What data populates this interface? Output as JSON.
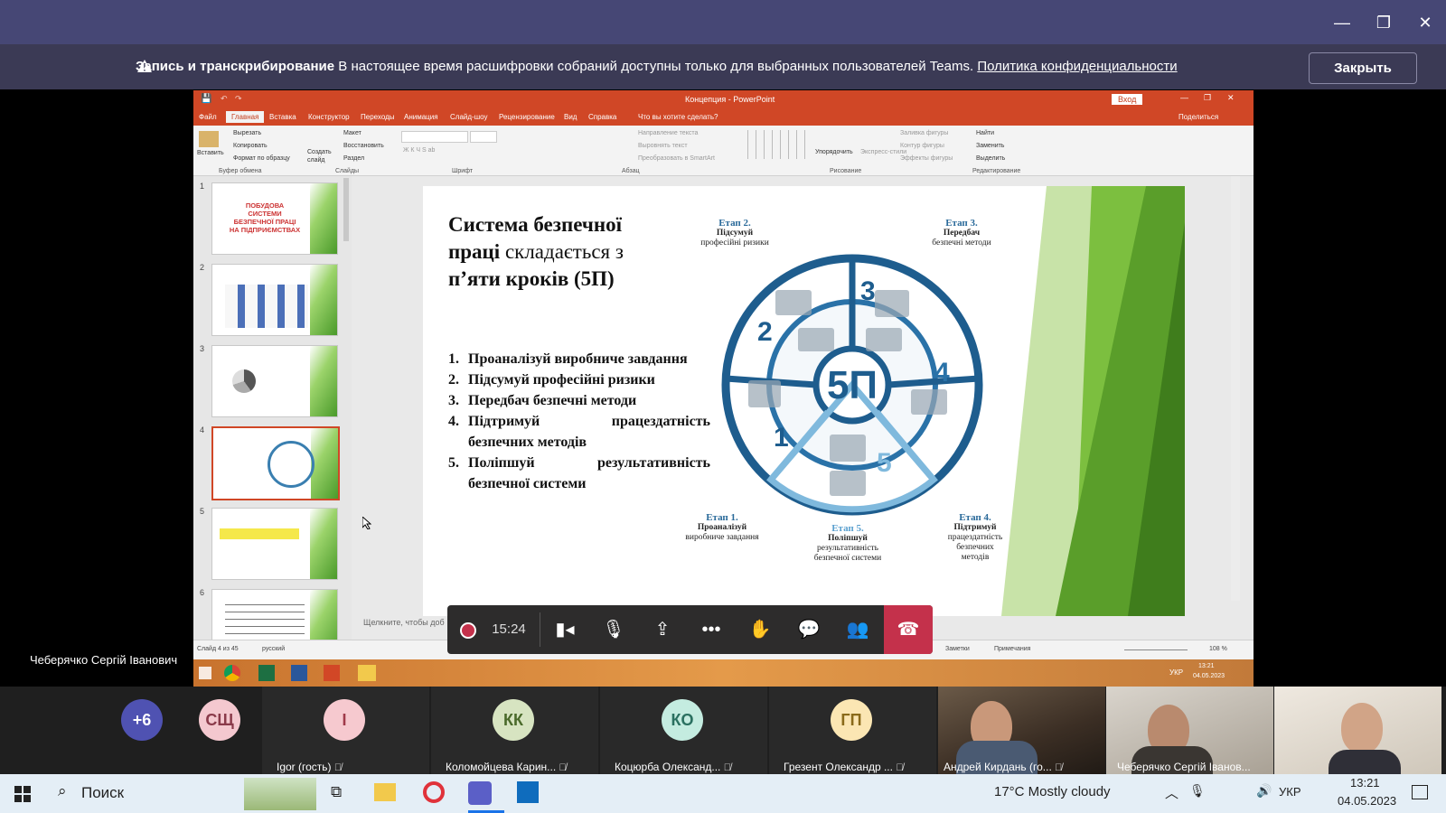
{
  "window": {
    "minimize": "—",
    "maximize": "❐",
    "close": "✕"
  },
  "banner": {
    "title": "Запись и транскрибирование",
    "message": "В настоящее время расшифровки собраний доступны только для выбранных пользователей Teams.",
    "link": "Политика конфиденциальности",
    "close_label": "Закрыть"
  },
  "powerpoint": {
    "title": "Концепция - PowerPoint",
    "signin": "Вход",
    "share": "Поделиться",
    "tabs": [
      "Файл",
      "Главная",
      "Вставка",
      "Конструктор",
      "Переходы",
      "Анимация",
      "Слайд-шоу",
      "Рецензирование",
      "Вид",
      "Справка",
      "Что вы хотите сделать?"
    ],
    "ribbon": {
      "paste": "Вставить",
      "cut": "Вырезать",
      "copy": "Копировать",
      "format": "Формат по образцу",
      "clipboard": "Буфер обмена",
      "new_slide": "Создать слайд",
      "layout": "Макет",
      "reset": "Восстановить",
      "section": "Раздел",
      "slides": "Слайды",
      "font": "Шрифт",
      "paragraph": "Абзац",
      "text_dir": "Направление текста",
      "align_text": "Выровнять текст",
      "smartart": "Преобразовать в SmartArt",
      "arrange": "Упорядочить",
      "quick_styles": "Экспресс-стили",
      "fill": "Заливка фигуры",
      "outline": "Контур фигуры",
      "effects": "Эффекты фигуры",
      "drawing": "Рисование",
      "find": "Найти",
      "replace": "Заменить",
      "select": "Выделить",
      "editing": "Редактирование"
    },
    "thumb_numbers": [
      "1",
      "2",
      "3",
      "4",
      "5",
      "6"
    ],
    "thumb1_text": "ПОБУДОВА СИСТЕМИ БЕЗПЕЧНОЇ ПРАЦІ НА ПІДПРИЄМСТВАХ",
    "notes_placeholder": "Щелкните, чтобы доб",
    "status": {
      "slide": "Слайд 4 из 45",
      "lang": "русский",
      "notes": "Заметки",
      "comments": "Примечания",
      "zoom": "108 %"
    },
    "tray": {
      "lang": "УКР",
      "time": "13:21",
      "date": "04.05.2023"
    }
  },
  "slide": {
    "title_bold_1": "Система безпечної",
    "title_bold_2": "праці",
    "title_normal": " складається з",
    "title_bold_3": "п’яти кроків (5П)",
    "steps": [
      {
        "n": "1.",
        "text": "Проаналізуй виробниче завдання"
      },
      {
        "n": "2.",
        "text": "Підсумуй професійні ризики"
      },
      {
        "n": "3.",
        "text": "Передбач безпечні методи"
      },
      {
        "n": "4.",
        "text": "Підтримуй працездатність безпечних методів"
      },
      {
        "n": "5.",
        "text": "Поліпшуй результативність безпечної системи"
      }
    ],
    "center": "5П",
    "sector_numbers": [
      "1",
      "2",
      "3",
      "4",
      "5"
    ],
    "etap2": {
      "h": "Етап 2.",
      "b": "Підсумуй",
      "t": "професійні ризики"
    },
    "etap3": {
      "h": "Етап 3.",
      "b": "Передбач",
      "t": "безпечні методи"
    },
    "etap1": {
      "h": "Етап 1.",
      "b": "Проаналізуй",
      "t": "виробниче завдання"
    },
    "etap5": {
      "h": "Етап 5.",
      "b": "Поліпшуй",
      "t": "результативність безпечної системи"
    },
    "etap4": {
      "h": "Етап 4.",
      "b": "Підтримуй",
      "t": "працездатність безпечних методів"
    }
  },
  "call": {
    "timer": "15:24"
  },
  "presenter": "Чеберячко Сергій Іванович",
  "participants": [
    {
      "initials": "+6",
      "name": "",
      "color": "#4f52b2",
      "fg": "#ffffff"
    },
    {
      "initials": "СЩ",
      "name": "",
      "color": "#f4c8cf",
      "fg": "#8a3a4a"
    },
    {
      "initials": "I",
      "name": "Igor (гость)",
      "color": "#f6c9cf",
      "fg": "#a03a4a"
    },
    {
      "initials": "КК",
      "name": "Коломойцева Карин...",
      "color": "#d7e4c1",
      "fg": "#4a6a2a"
    },
    {
      "initials": "КО",
      "name": "Коцюрба Олександ...",
      "color": "#c4ece0",
      "fg": "#2a7060"
    },
    {
      "initials": "ГП",
      "name": "Грезент Олександр ...",
      "color": "#fbe6b3",
      "fg": "#8a6a1a"
    }
  ],
  "video_names": [
    "Андрей Кирдань (го...",
    "Чеберячко Сергій Іванов...",
    ""
  ],
  "taskbar": {
    "search": "Поиск",
    "weather": "17°C  Mostly cloudy",
    "lang": "УКР",
    "time": "13:21",
    "date": "04.05.2023"
  }
}
